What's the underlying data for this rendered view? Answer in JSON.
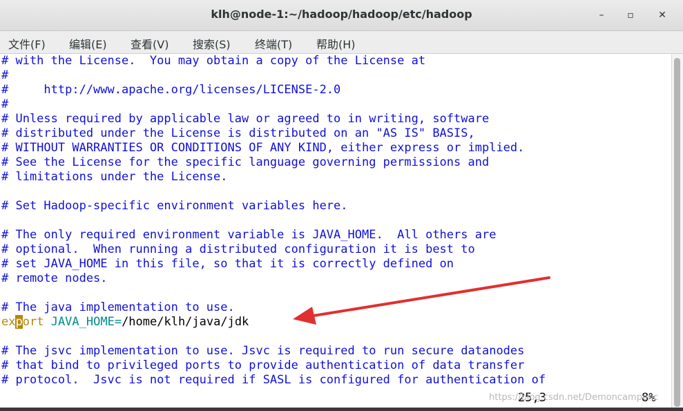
{
  "window": {
    "title": "klh@node-1:~/hadoop/hadoop/etc/hadoop",
    "controls": {
      "minimize": "–",
      "maximize": "▫",
      "close": "✕"
    }
  },
  "menu": [
    "文件(F)",
    "编辑(E)",
    "查看(V)",
    "搜索(S)",
    "终端(T)",
    "帮助(H)"
  ],
  "terminal_lines": [
    "# with the License.  You may obtain a copy of the License at",
    "#",
    "#     http://www.apache.org/licenses/LICENSE-2.0",
    "#",
    "# Unless required by applicable law or agreed to in writing, software",
    "# distributed under the License is distributed on an \"AS IS\" BASIS,",
    "# WITHOUT WARRANTIES OR CONDITIONS OF ANY KIND, either express or implied.",
    "# See the License for the specific language governing permissions and",
    "# limitations under the License.",
    "",
    "# Set Hadoop-specific environment variables here.",
    "",
    "# The only required environment variable is JAVA_HOME.  All others are",
    "# optional.  When running a distributed configuration it is best to",
    "# set JAVA_HOME in this file, so that it is correctly defined on",
    "# remote nodes.",
    "",
    "# The java implementation to use."
  ],
  "export_line": {
    "kw_before": "ex",
    "cursor_char": "p",
    "kw_after": "ort",
    "space": " ",
    "var": "JAVA_HOME=",
    "path": "/home/klh/java/jdk"
  },
  "terminal_lines_after": [
    "",
    "# The jsvc implementation to use. Jsvc is required to run secure datanodes",
    "# that bind to privileged ports to provide authentication of data transfer",
    "# protocol.  Jsvc is not required if SASL is configured for authentication of"
  ],
  "status": {
    "position": "25,3",
    "percent": "8%"
  },
  "watermark": "https://blog.csdn.net/Demoncamper.c",
  "colors": {
    "comment": "#1010d8",
    "keyword": "#b8860b",
    "variable": "#008b8b",
    "arrow": "#e03030"
  }
}
